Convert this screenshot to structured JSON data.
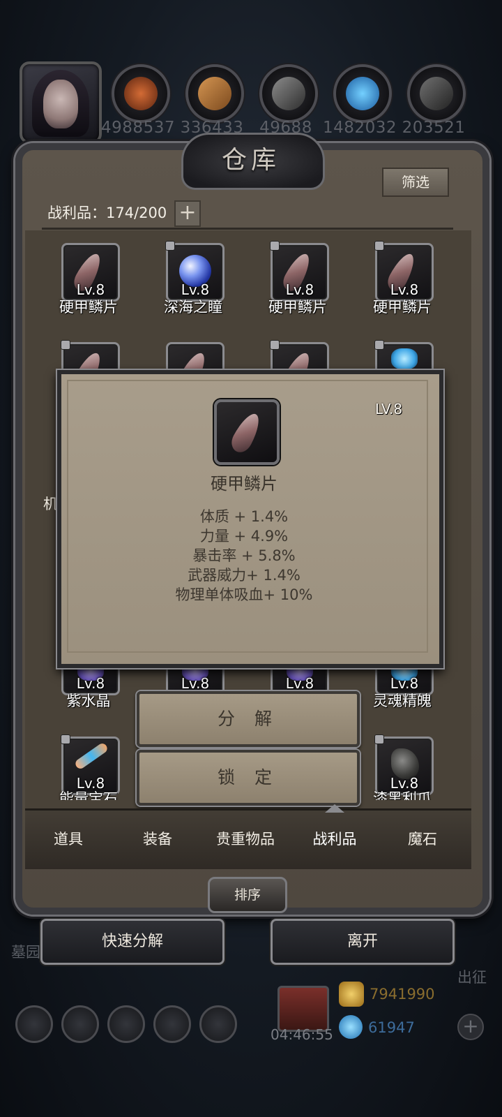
{
  "resources": [
    {
      "icon": "meat-icon",
      "count": "4988537",
      "color": "#b5532a"
    },
    {
      "icon": "wood-icon",
      "count": "336433",
      "color": "#b97a3a"
    },
    {
      "icon": "ore-icon",
      "count": "49688",
      "color": "#6e6e6e"
    },
    {
      "icon": "crystal-icon",
      "count": "1482032",
      "color": "#3aa2e6"
    },
    {
      "icon": "iron-icon",
      "count": "203521",
      "color": "#5a5a5a"
    }
  ],
  "header": {
    "title": "仓库",
    "filter_label": "筛选"
  },
  "loot": {
    "label": "战利品：174/200",
    "plus_label": "+"
  },
  "items": [
    {
      "name": "硬甲鳞片",
      "level": "Lv.8",
      "icon": "scale-icon"
    },
    {
      "name": "深海之瞳",
      "level": "Lv.8",
      "icon": "orb-icon"
    },
    {
      "name": "硬甲鳞片",
      "level": "Lv.8",
      "icon": "scale-icon"
    },
    {
      "name": "硬甲鳞片",
      "level": "Lv.8",
      "icon": "scale-icon"
    },
    {
      "name": "紫水晶",
      "level": "Lv.8",
      "icon": "amethyst-icon"
    },
    {
      "name": "",
      "level": "Lv.8",
      "icon": "amethyst-icon"
    },
    {
      "name": "",
      "level": "Lv.8",
      "icon": "amethyst-icon"
    },
    {
      "name": "灵魂精魄",
      "level": "Lv.8",
      "icon": "soul-icon"
    },
    {
      "name": "能量宝石",
      "level": "Lv.8",
      "icon": "energy-gem-icon"
    },
    {
      "name": "漆黑利爪",
      "level": "Lv.8",
      "icon": "claw-icon"
    }
  ],
  "side_left_text": "机",
  "detail": {
    "level": "LV.8",
    "name": "硬甲鳞片",
    "stats": [
      "体质 + 1.4%",
      "力量 + 4.9%",
      "暴击率 + 5.8%",
      "武器威力+ 1.4%",
      "物理单体吸血+ 10%"
    ]
  },
  "actions": {
    "decompose": "分 解",
    "lock": "锁 定"
  },
  "tabs": [
    {
      "label": "道具"
    },
    {
      "label": "装备"
    },
    {
      "label": "贵重物品"
    },
    {
      "label": "战利品",
      "active": true
    },
    {
      "label": "魔石"
    }
  ],
  "sort_label": "排序",
  "bottom": {
    "quick_decompose": "快速分解",
    "leave": "离开"
  },
  "hud": {
    "timer": "04:46:55",
    "gold": "7941990",
    "gems": "61947",
    "left_label": "墓园",
    "right_label": "出征"
  }
}
